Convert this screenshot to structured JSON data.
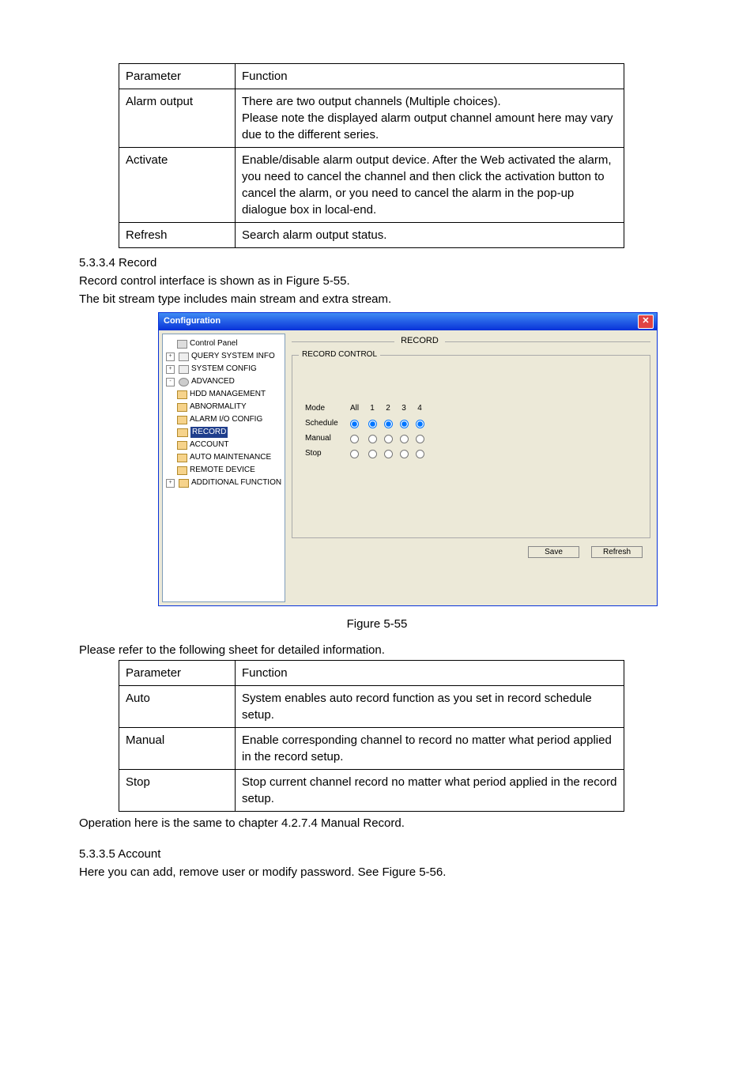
{
  "table1": {
    "header": {
      "c1": "Parameter",
      "c2": "Function"
    },
    "rows": [
      {
        "c1": "Alarm output",
        "c2": "There are two output channels (Multiple choices).\nPlease note the displayed alarm output channel amount here may vary due to the different series."
      },
      {
        "c1": "Activate",
        "c2": "Enable/disable alarm output device. After the Web activated the alarm, you need to cancel the channel and then click the activation button to cancel the alarm, or you need to cancel the alarm in the pop-up dialogue box in local-end."
      },
      {
        "c1": "Refresh",
        "c2": "Search alarm output status."
      }
    ]
  },
  "sec1": {
    "heading": "5.3.3.4  Record",
    "p1": "Record control interface is shown as in Figure 5-55.",
    "p2": "The bit stream type includes main stream and extra stream."
  },
  "figwin": {
    "title": "Configuration",
    "group_title": "RECORD",
    "legend": "RECORD CONTROL",
    "tree": {
      "items": [
        {
          "label": "Control Panel",
          "lvl": 1,
          "exp": "",
          "ico": "panel"
        },
        {
          "label": "QUERY SYSTEM INFO",
          "lvl": 1,
          "exp": "+",
          "ico": "sys"
        },
        {
          "label": "SYSTEM CONFIG",
          "lvl": 1,
          "exp": "+",
          "ico": "sys"
        },
        {
          "label": "ADVANCED",
          "lvl": 1,
          "exp": "-",
          "ico": "gears"
        },
        {
          "label": "HDD MANAGEMENT",
          "lvl": 2,
          "ico": "folder"
        },
        {
          "label": "ABNORMALITY",
          "lvl": 2,
          "ico": "folder"
        },
        {
          "label": "ALARM I/O CONFIG",
          "lvl": 2,
          "ico": "folder"
        },
        {
          "label": "RECORD",
          "lvl": 2,
          "ico": "folder-open",
          "selected": true
        },
        {
          "label": "ACCOUNT",
          "lvl": 2,
          "ico": "folder"
        },
        {
          "label": "AUTO MAINTENANCE",
          "lvl": 2,
          "ico": "folder"
        },
        {
          "label": "REMOTE DEVICE",
          "lvl": 2,
          "ico": "folder"
        },
        {
          "label": "ADDITIONAL FUNCTION",
          "lvl": 1,
          "exp": "+",
          "ico": "folder"
        }
      ]
    },
    "grid": {
      "cols": [
        "Mode",
        "All",
        "1",
        "2",
        "3",
        "4"
      ],
      "rows": [
        {
          "label": "Schedule",
          "sel": [
            true,
            true,
            true,
            true,
            true
          ]
        },
        {
          "label": "Manual",
          "sel": [
            false,
            false,
            false,
            false,
            false
          ]
        },
        {
          "label": "Stop",
          "sel": [
            false,
            false,
            false,
            false,
            false
          ]
        }
      ]
    },
    "buttons": {
      "save": "Save",
      "refresh": "Refresh"
    }
  },
  "figcaption": "Figure 5-55",
  "p_after_fig": "Please refer to the following sheet for detailed information.",
  "table2": {
    "header": {
      "c1": "Parameter",
      "c2": "Function"
    },
    "rows": [
      {
        "c1": "Auto",
        "c2": "System enables auto record function as you set in record schedule setup."
      },
      {
        "c1": "Manual",
        "c2": "Enable corresponding channel to record no matter what period applied in the record setup."
      },
      {
        "c1": "Stop",
        "c2": "Stop current channel record no matter what period applied in the record setup."
      }
    ]
  },
  "p_after_t2": "Operation here is the same to chapter 4.2.7.4 Manual Record.",
  "sec2": {
    "heading": "5.3.3.5  Account",
    "p1": "Here you can add, remove user or modify password. See Figure 5-56."
  }
}
